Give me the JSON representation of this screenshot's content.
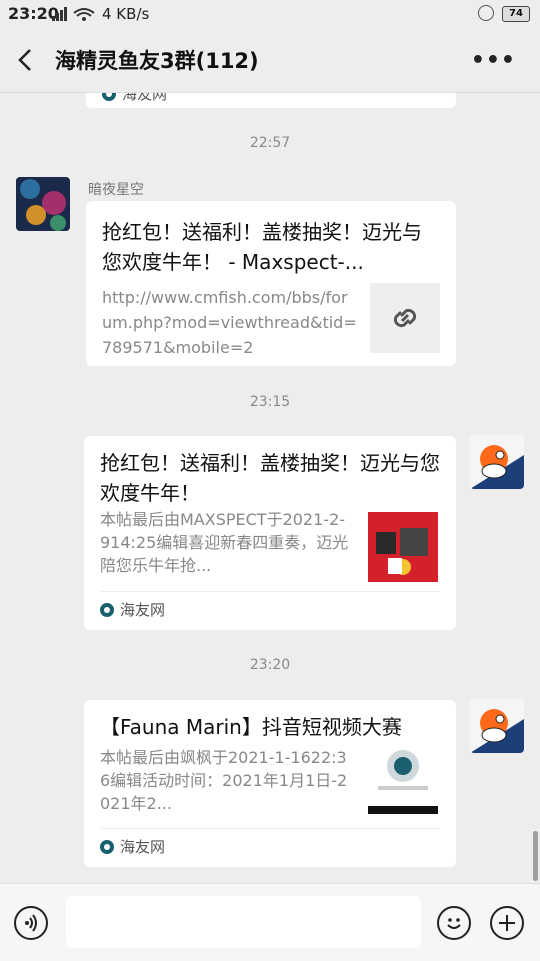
{
  "status": {
    "time": "23:20",
    "speed": "4 KB/s",
    "battery": "74"
  },
  "header": {
    "title": "海精灵鱼友3群(112)",
    "more": "•••"
  },
  "messages": {
    "top_source": "海友网",
    "ts1": "22:57",
    "msg1": {
      "sender": "暗夜星空",
      "title": "抢红包！送福利！盖楼抽奖！迈光与您欢度牛年！ - Maxspect-...",
      "desc": "http://www.cmfish.com/bbs/forum.php?mod=viewthread&tid=789571&mobile=2"
    },
    "ts2": "23:15",
    "msg2": {
      "title": "抢红包！送福利！盖楼抽奖！迈光与您欢度牛年！",
      "desc": "本帖最后由MAXSPECT于2021-2-914:25编辑喜迎新春四重奏，迈光陪您乐牛年抢...",
      "source": "海友网"
    },
    "ts3": "23:20",
    "msg3": {
      "title": "【Fauna Marin】抖音短视频大赛",
      "desc": "本帖最后由飒枫于2021-1-1622:36编辑活动时间：2021年1月1日-2021年2...",
      "source": "海友网"
    }
  },
  "colors": {
    "bg": "#ededed",
    "card": "#ffffff",
    "accent": "#1a5f6e"
  }
}
